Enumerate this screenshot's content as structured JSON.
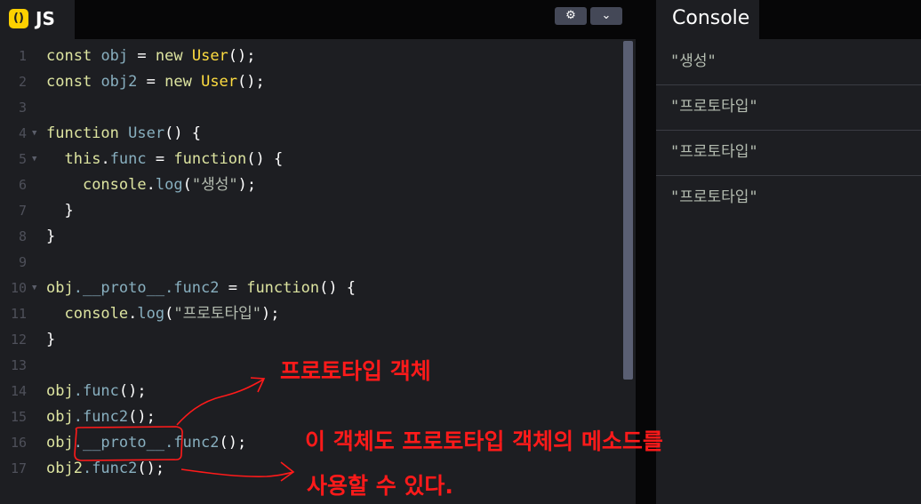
{
  "editor": {
    "tab_badge": "()",
    "tab_label": "JS",
    "settings_icon": "gear-icon",
    "collapse_icon": "chevron-down-icon",
    "line_numbers": [
      "1",
      "2",
      "3",
      "4",
      "5",
      "6",
      "7",
      "8",
      "9",
      "10",
      "11",
      "12",
      "13",
      "14",
      "15",
      "16",
      "17"
    ],
    "code": {
      "l1": {
        "kw": "const",
        "var": "obj",
        "eq": " = ",
        "kw2": "new",
        "fn": "User",
        "rest": "();"
      },
      "l2": {
        "kw": "const",
        "var": "obj2",
        "eq": " = ",
        "kw2": "new",
        "fn": "User",
        "rest": "();"
      },
      "l4": {
        "kw": "function",
        "fn": "User",
        "rest": "() {"
      },
      "l5": {
        "kw": "this",
        "dot": ".",
        "prop": "func",
        "eq": " = ",
        "kw2": "function",
        "rest": "() {"
      },
      "l6": {
        "obj": "console",
        "dot": ".",
        "prop": "log",
        "p1": "(",
        "str": "\"생성\"",
        "p2": ");"
      },
      "l7": {
        "text": "}"
      },
      "l8": {
        "text": "}"
      },
      "l10": {
        "obj": "obj",
        "prop": ".__proto__.func2",
        "eq": " = ",
        "kw": "function",
        "rest": "() {"
      },
      "l11": {
        "obj": "console",
        "dot": ".",
        "prop": "log",
        "p1": "(",
        "str": "\"프로토타입\"",
        "p2": ");"
      },
      "l12": {
        "text": "}"
      },
      "l14": {
        "obj": "obj",
        "prop": ".func",
        "rest": "();"
      },
      "l15": {
        "obj": "obj",
        "prop": ".func2",
        "rest": "();"
      },
      "l16": {
        "obj": "obj",
        "prop": ".__proto__.func2",
        "rest": "();"
      },
      "l17": {
        "obj": "obj2",
        "prop": ".func2",
        "rest": "();"
      }
    }
  },
  "console": {
    "title": "Console",
    "outputs": [
      "\"생성\"",
      "\"프로토타입\"",
      "\"프로토타입\"",
      "\"프로토타입\""
    ]
  },
  "annotations": {
    "note1": "프로토타입 객체",
    "note2": "이 객체도 프로토타입 객체의 메소드를",
    "note3": "사용할 수 있다.",
    "ink_color": "#ff1a1a"
  },
  "colors": {
    "keyword": "#dde4a0",
    "function": "#ffdd40",
    "variable": "#88afbf",
    "string": "#b4bcb0",
    "background": "#1d1e22",
    "header": "#060607"
  }
}
